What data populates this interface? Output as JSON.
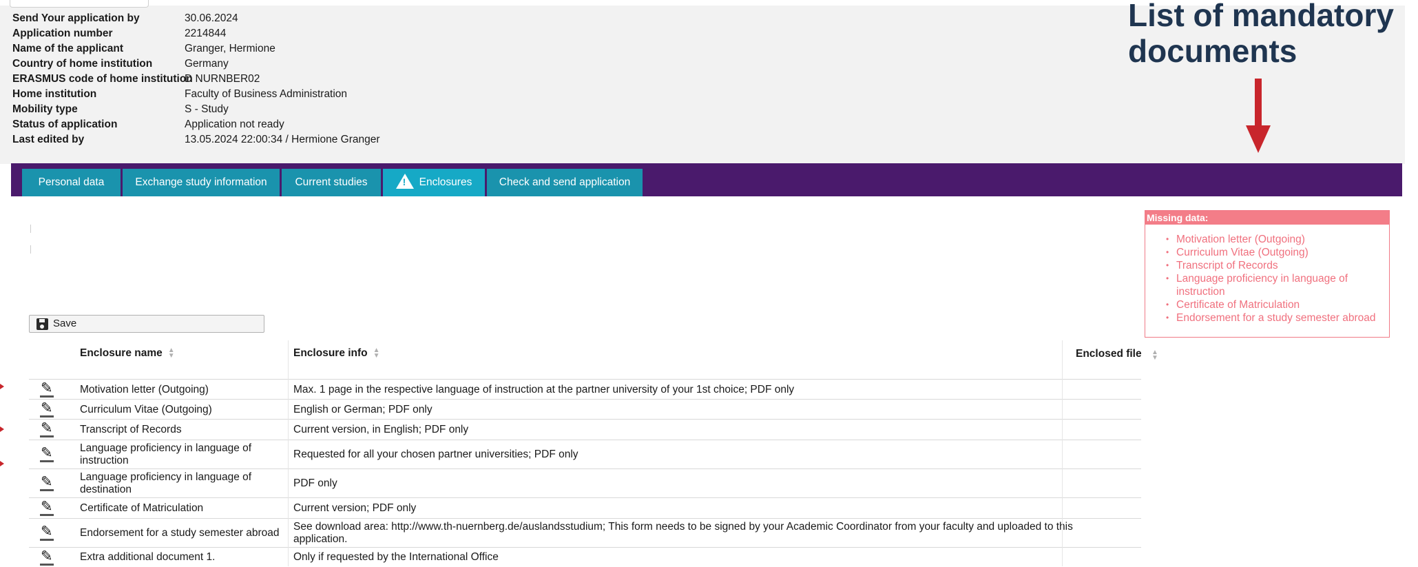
{
  "application_info": [
    {
      "label": "Send Your application by",
      "value": "30.06.2024"
    },
    {
      "label": "Application number",
      "value": "2214844"
    },
    {
      "label": "Name of the applicant",
      "value": "Granger, Hermione"
    },
    {
      "label": "Country of home institution",
      "value": "Germany"
    },
    {
      "label": "ERASMUS code of home institution",
      "value": "D NURNBER02"
    },
    {
      "label": "Home institution",
      "value": "Faculty of Business Administration"
    },
    {
      "label": "Mobility type",
      "value": "S - Study"
    },
    {
      "label": "Status of application",
      "value": "Application not ready"
    },
    {
      "label": "Last edited by",
      "value": "13.05.2024 22:00:34 / Hermione Granger"
    }
  ],
  "tabs": [
    {
      "label": "Personal data",
      "active": false
    },
    {
      "label": "Exchange study information",
      "active": false
    },
    {
      "label": "Current studies",
      "active": false
    },
    {
      "label": "Enclosures",
      "active": true,
      "icon": "warning-icon"
    },
    {
      "label": "Check and send application",
      "active": false
    }
  ],
  "annotation": {
    "title_line1": "List of mandatory",
    "title_line2": "documents",
    "color": "#1f3550",
    "arrow_color": "#c8262c"
  },
  "missing_data": {
    "heading": "Missing data:",
    "items": [
      "Motivation letter (Outgoing)",
      "Curriculum Vitae (Outgoing)",
      "Transcript of Records",
      "Language proficiency in language of instruction",
      "Certificate of Matriculation",
      "Endorsement for a study semester abroad"
    ]
  },
  "save_button": {
    "label": "Save",
    "icon": "floppy-disk-icon"
  },
  "table": {
    "headers": {
      "name": "Enclosure name",
      "info": "Enclosure info",
      "file": "Enclosed file"
    },
    "rows": [
      {
        "name": "Motivation letter (Outgoing)",
        "info": "Max. 1 page in the respective language of instruction at the partner university of your 1st choice; PDF only"
      },
      {
        "name": "Curriculum Vitae (Outgoing)",
        "info": "English or German; PDF only"
      },
      {
        "name": "Transcript of Records",
        "info": "Current version, in English; PDF only"
      },
      {
        "name": "Language proficiency in language of instruction",
        "info": "Requested for all your chosen partner universities; PDF only"
      },
      {
        "name": "Language proficiency in language of destination",
        "info": "PDF only"
      },
      {
        "name": "Certificate of Matriculation",
        "info": "Current version; PDF only"
      },
      {
        "name": "Endorsement for a study semester abroad",
        "info": "See download area: http://www.th-nuernberg.de/auslandsstudium; This form needs to be signed by your Academic Coordinator from your faculty and uploaded to this application."
      },
      {
        "name": "Extra additional document 1.",
        "info": "Only if requested by the International Office"
      }
    ]
  },
  "colors": {
    "nav_bar": "#4a1a6c",
    "tab": "#1a93ad",
    "tab_active": "#16a9c6",
    "missing_accent": "#f37d88"
  }
}
